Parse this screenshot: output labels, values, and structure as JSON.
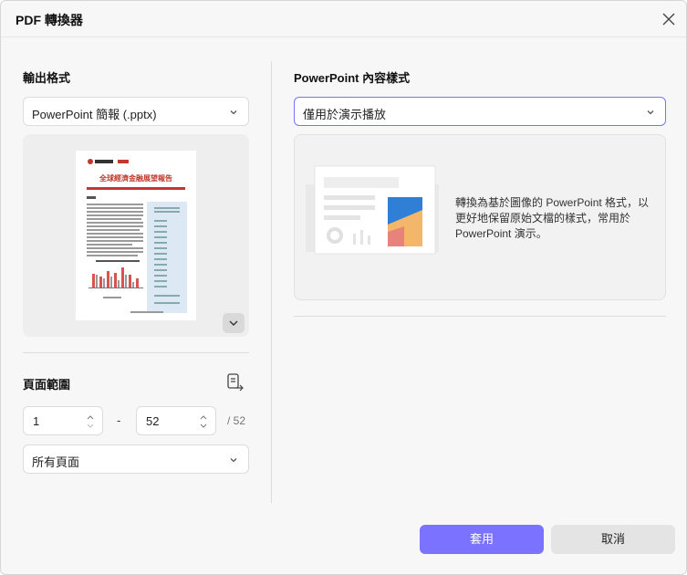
{
  "window": {
    "title": "PDF 轉換器"
  },
  "output_format": {
    "label": "輸出格式",
    "selected": "PowerPoint 簡報 (.pptx)"
  },
  "preview": {
    "doc_title": "全球經濟金融展望報告"
  },
  "page_range": {
    "label": "頁面範圍",
    "from": "1",
    "to": "52",
    "separator": "-",
    "total": "/ 52",
    "subset_selected": "所有頁面"
  },
  "ppt_style": {
    "label": "PowerPoint 內容樣式",
    "selected": "僅用於演示播放",
    "description": "轉換為基於圖像的 PowerPoint 格式，以更好地保留原始文檔的樣式，常用於 PowerPoint 演示。"
  },
  "actions": {
    "apply": "套用",
    "cancel": "取消"
  },
  "colors": {
    "accent": "#7b73ff",
    "card_blue": "#2f7fd6",
    "card_orange": "#f4b76a",
    "card_red": "#e8837b"
  }
}
